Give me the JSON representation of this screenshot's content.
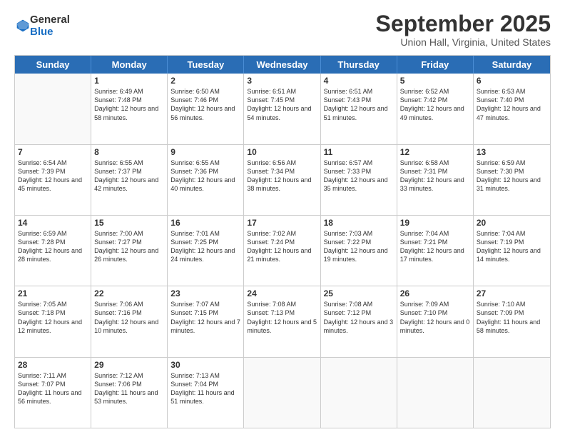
{
  "logo": {
    "general": "General",
    "blue": "Blue"
  },
  "header": {
    "title": "September 2025",
    "location": "Union Hall, Virginia, United States"
  },
  "days": [
    "Sunday",
    "Monday",
    "Tuesday",
    "Wednesday",
    "Thursday",
    "Friday",
    "Saturday"
  ],
  "weeks": [
    [
      {
        "day": "",
        "empty": true
      },
      {
        "day": "1",
        "sunrise": "Sunrise: 6:49 AM",
        "sunset": "Sunset: 7:48 PM",
        "daylight": "Daylight: 12 hours and 58 minutes."
      },
      {
        "day": "2",
        "sunrise": "Sunrise: 6:50 AM",
        "sunset": "Sunset: 7:46 PM",
        "daylight": "Daylight: 12 hours and 56 minutes."
      },
      {
        "day": "3",
        "sunrise": "Sunrise: 6:51 AM",
        "sunset": "Sunset: 7:45 PM",
        "daylight": "Daylight: 12 hours and 54 minutes."
      },
      {
        "day": "4",
        "sunrise": "Sunrise: 6:51 AM",
        "sunset": "Sunset: 7:43 PM",
        "daylight": "Daylight: 12 hours and 51 minutes."
      },
      {
        "day": "5",
        "sunrise": "Sunrise: 6:52 AM",
        "sunset": "Sunset: 7:42 PM",
        "daylight": "Daylight: 12 hours and 49 minutes."
      },
      {
        "day": "6",
        "sunrise": "Sunrise: 6:53 AM",
        "sunset": "Sunset: 7:40 PM",
        "daylight": "Daylight: 12 hours and 47 minutes."
      }
    ],
    [
      {
        "day": "7",
        "sunrise": "Sunrise: 6:54 AM",
        "sunset": "Sunset: 7:39 PM",
        "daylight": "Daylight: 12 hours and 45 minutes."
      },
      {
        "day": "8",
        "sunrise": "Sunrise: 6:55 AM",
        "sunset": "Sunset: 7:37 PM",
        "daylight": "Daylight: 12 hours and 42 minutes."
      },
      {
        "day": "9",
        "sunrise": "Sunrise: 6:55 AM",
        "sunset": "Sunset: 7:36 PM",
        "daylight": "Daylight: 12 hours and 40 minutes."
      },
      {
        "day": "10",
        "sunrise": "Sunrise: 6:56 AM",
        "sunset": "Sunset: 7:34 PM",
        "daylight": "Daylight: 12 hours and 38 minutes."
      },
      {
        "day": "11",
        "sunrise": "Sunrise: 6:57 AM",
        "sunset": "Sunset: 7:33 PM",
        "daylight": "Daylight: 12 hours and 35 minutes."
      },
      {
        "day": "12",
        "sunrise": "Sunrise: 6:58 AM",
        "sunset": "Sunset: 7:31 PM",
        "daylight": "Daylight: 12 hours and 33 minutes."
      },
      {
        "day": "13",
        "sunrise": "Sunrise: 6:59 AM",
        "sunset": "Sunset: 7:30 PM",
        "daylight": "Daylight: 12 hours and 31 minutes."
      }
    ],
    [
      {
        "day": "14",
        "sunrise": "Sunrise: 6:59 AM",
        "sunset": "Sunset: 7:28 PM",
        "daylight": "Daylight: 12 hours and 28 minutes."
      },
      {
        "day": "15",
        "sunrise": "Sunrise: 7:00 AM",
        "sunset": "Sunset: 7:27 PM",
        "daylight": "Daylight: 12 hours and 26 minutes."
      },
      {
        "day": "16",
        "sunrise": "Sunrise: 7:01 AM",
        "sunset": "Sunset: 7:25 PM",
        "daylight": "Daylight: 12 hours and 24 minutes."
      },
      {
        "day": "17",
        "sunrise": "Sunrise: 7:02 AM",
        "sunset": "Sunset: 7:24 PM",
        "daylight": "Daylight: 12 hours and 21 minutes."
      },
      {
        "day": "18",
        "sunrise": "Sunrise: 7:03 AM",
        "sunset": "Sunset: 7:22 PM",
        "daylight": "Daylight: 12 hours and 19 minutes."
      },
      {
        "day": "19",
        "sunrise": "Sunrise: 7:04 AM",
        "sunset": "Sunset: 7:21 PM",
        "daylight": "Daylight: 12 hours and 17 minutes."
      },
      {
        "day": "20",
        "sunrise": "Sunrise: 7:04 AM",
        "sunset": "Sunset: 7:19 PM",
        "daylight": "Daylight: 12 hours and 14 minutes."
      }
    ],
    [
      {
        "day": "21",
        "sunrise": "Sunrise: 7:05 AM",
        "sunset": "Sunset: 7:18 PM",
        "daylight": "Daylight: 12 hours and 12 minutes."
      },
      {
        "day": "22",
        "sunrise": "Sunrise: 7:06 AM",
        "sunset": "Sunset: 7:16 PM",
        "daylight": "Daylight: 12 hours and 10 minutes."
      },
      {
        "day": "23",
        "sunrise": "Sunrise: 7:07 AM",
        "sunset": "Sunset: 7:15 PM",
        "daylight": "Daylight: 12 hours and 7 minutes."
      },
      {
        "day": "24",
        "sunrise": "Sunrise: 7:08 AM",
        "sunset": "Sunset: 7:13 PM",
        "daylight": "Daylight: 12 hours and 5 minutes."
      },
      {
        "day": "25",
        "sunrise": "Sunrise: 7:08 AM",
        "sunset": "Sunset: 7:12 PM",
        "daylight": "Daylight: 12 hours and 3 minutes."
      },
      {
        "day": "26",
        "sunrise": "Sunrise: 7:09 AM",
        "sunset": "Sunset: 7:10 PM",
        "daylight": "Daylight: 12 hours and 0 minutes."
      },
      {
        "day": "27",
        "sunrise": "Sunrise: 7:10 AM",
        "sunset": "Sunset: 7:09 PM",
        "daylight": "Daylight: 11 hours and 58 minutes."
      }
    ],
    [
      {
        "day": "28",
        "sunrise": "Sunrise: 7:11 AM",
        "sunset": "Sunset: 7:07 PM",
        "daylight": "Daylight: 11 hours and 56 minutes."
      },
      {
        "day": "29",
        "sunrise": "Sunrise: 7:12 AM",
        "sunset": "Sunset: 7:06 PM",
        "daylight": "Daylight: 11 hours and 53 minutes."
      },
      {
        "day": "30",
        "sunrise": "Sunrise: 7:13 AM",
        "sunset": "Sunset: 7:04 PM",
        "daylight": "Daylight: 11 hours and 51 minutes."
      },
      {
        "day": "",
        "empty": true
      },
      {
        "day": "",
        "empty": true
      },
      {
        "day": "",
        "empty": true
      },
      {
        "day": "",
        "empty": true
      }
    ]
  ]
}
